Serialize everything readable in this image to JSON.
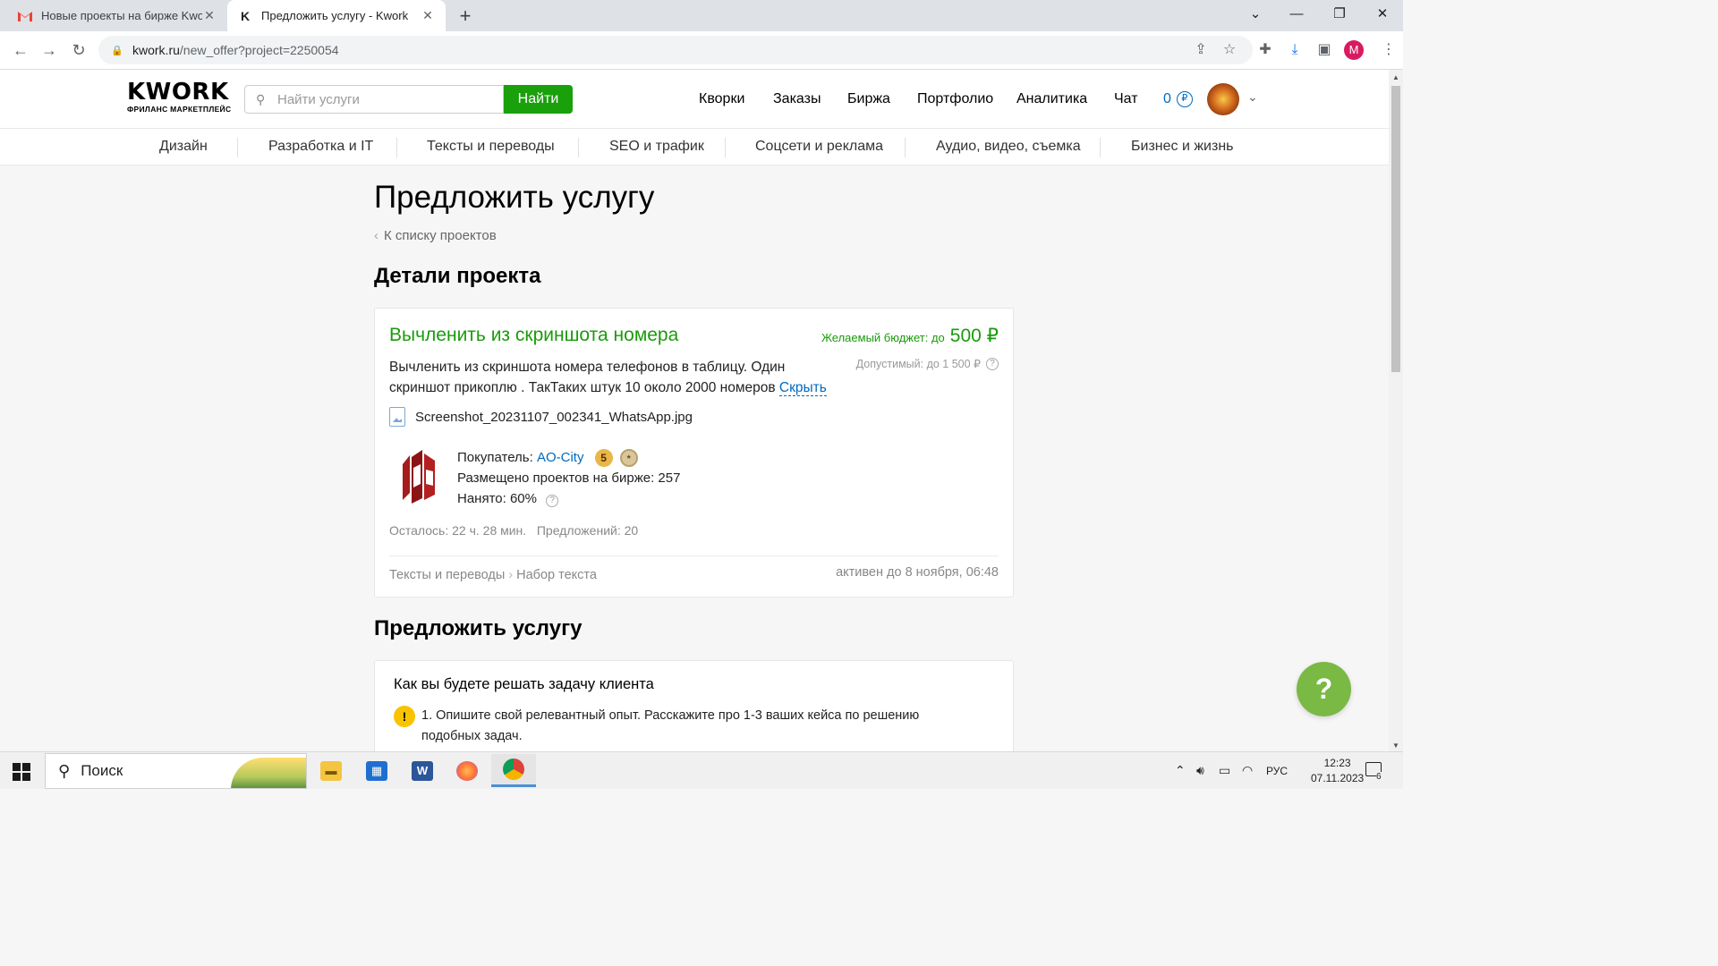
{
  "browser": {
    "tabs": [
      {
        "title": "Новые проекты на бирже Kwork",
        "icon": "gmail-icon"
      },
      {
        "title": "Предложить услугу - Kwork",
        "icon": "kwork-icon"
      }
    ],
    "url_host": "kwork.ru",
    "url_path": "/new_offer?project=2250054",
    "profile_initial": "M"
  },
  "header": {
    "logo_main": "KWORK",
    "logo_sub": "ФРИЛАНС МАРКЕТПЛЕЙС",
    "search_placeholder": "Найти услуги",
    "search_button": "Найти",
    "nav": [
      "Кворки",
      "Заказы",
      "Биржа",
      "Портфолио",
      "Аналитика",
      "Чат"
    ],
    "balance": "0",
    "currency_symbol": "₽"
  },
  "categories": [
    "Дизайн",
    "Разработка и IT",
    "Тексты и переводы",
    "SEO и трафик",
    "Соцсети и реклама",
    "Аудио, видео, съемка",
    "Бизнес и жизнь"
  ],
  "page": {
    "title": "Предложить услугу",
    "back_link": "К списку проектов",
    "details_heading": "Детали проекта",
    "offer_heading": "Предложить услугу"
  },
  "project": {
    "title": "Вычленить из скриншота номера",
    "budget_label": "Желаемый бюджет: до",
    "budget_value": "500 ₽",
    "allowed": "Допустимый: до 1 500 ₽",
    "description": "Вычленить из скриншота номера телефонов в таблицу. Один скриншот прикоплю . ТакТаких штук 10 около 2000 номеров",
    "hide_link": "Скрыть",
    "attachment": "Screenshot_20231107_002341_WhatsApp.jpg",
    "buyer_label": "Покупатель:",
    "buyer_name": "AO-City",
    "buyer_badge_level": "5",
    "posted_projects": "Размещено проектов на бирже: 257",
    "hired": "Нанято: 60%",
    "remaining": "Осталось: 22 ч. 28 мин.",
    "offers": "Предложений: 20",
    "category": "Тексты и переводы",
    "subcategory": "Набор текста",
    "active_until": "активен до 8 ноября, 06:48"
  },
  "offer_form": {
    "question": "Как вы будете решать задачу клиента",
    "tip": "1. Опишите свой релевантный опыт. Расскажите про 1-3 ваших кейса по решению подобных задач."
  },
  "help_button": "?",
  "taskbar": {
    "search_placeholder": "Поиск",
    "lang": "РУС",
    "time": "12:23",
    "date": "07.11.2023",
    "notifications": "6"
  },
  "colors": {
    "kwork_green": "#1aa00b",
    "link_blue": "#0069c0",
    "help_green": "#79b944"
  }
}
